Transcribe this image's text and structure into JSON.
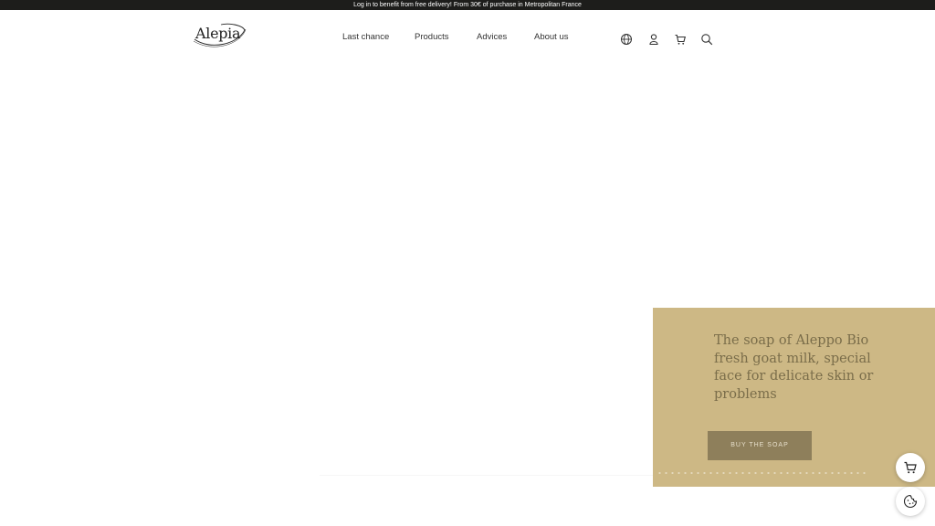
{
  "announcement": {
    "text": "Log in to benefit from free delivery! From 30€ of purchase in Metropolitan France"
  },
  "header": {
    "logo_text": "Alepia",
    "nav": [
      {
        "label": "Last chance"
      },
      {
        "label": "Products"
      },
      {
        "label": "Advices"
      },
      {
        "label": "About us"
      }
    ],
    "icons": [
      "globe-icon",
      "user-icon",
      "cart-icon",
      "search-icon"
    ]
  },
  "promo": {
    "title": "The soap of Aleppo Bio fresh goat milk, special face for delicate skin or problems",
    "button_label": "BUY THE SOAP",
    "colors": {
      "background": "#cdb885",
      "title": "#7a6d4a",
      "button": "#8e7f5b"
    }
  },
  "floating_buttons": [
    "cart-icon",
    "cookie-icon"
  ],
  "colors": {
    "topbar": "#1d1d1b",
    "nav_text": "#333333"
  }
}
